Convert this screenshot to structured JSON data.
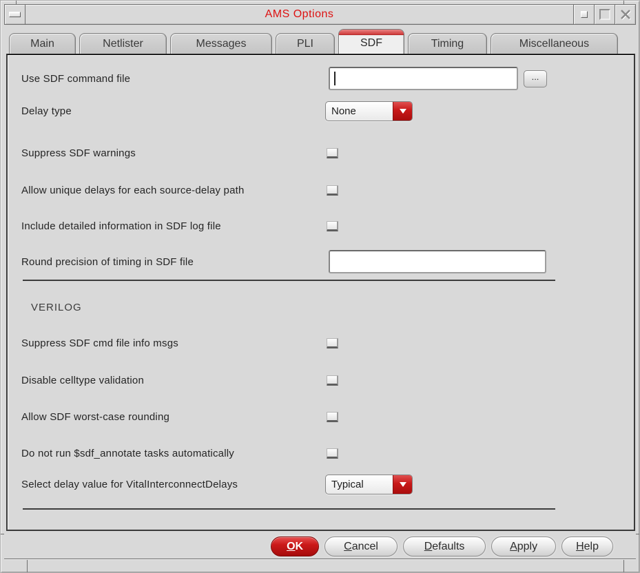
{
  "window": {
    "title": "AMS Options"
  },
  "tabs": [
    {
      "label": "Main",
      "active": false
    },
    {
      "label": "Netlister",
      "active": false
    },
    {
      "label": "Messages",
      "active": false
    },
    {
      "label": "PLI",
      "active": false
    },
    {
      "label": "SDF",
      "active": true
    },
    {
      "label": "Timing",
      "active": false
    },
    {
      "label": "Miscellaneous",
      "active": false
    }
  ],
  "form": {
    "sdf_file": {
      "label": "Use SDF command file",
      "value": "",
      "browse_label": "..."
    },
    "delay_type": {
      "label": "Delay type",
      "value": "None"
    },
    "suppress_warnings": {
      "label": "Suppress SDF warnings",
      "checked": false
    },
    "unique_delays": {
      "label": "Allow unique delays for each source-delay path",
      "checked": false
    },
    "detailed_info": {
      "label": "Include detailed information in SDF log file",
      "checked": false
    },
    "round_precision": {
      "label": "Round precision of timing in SDF file",
      "value": ""
    },
    "verilog_section": {
      "label": "VERILOG"
    },
    "suppress_info_msgs": {
      "label": "Suppress SDF cmd file info msgs",
      "checked": false
    },
    "disable_celltype": {
      "label": "Disable celltype validation",
      "checked": false
    },
    "worst_case": {
      "label": "Allow SDF worst-case rounding",
      "checked": false
    },
    "no_sdf_annotate": {
      "label": "Do not run $sdf_annotate tasks automatically",
      "checked": false
    },
    "vital_delay": {
      "label": "Select delay value for VitalInterconnectDelays",
      "value": "Typical"
    }
  },
  "footer": {
    "ok": "OK",
    "cancel": "Cancel",
    "defaults": "Defaults",
    "apply": "Apply",
    "help": "Help"
  },
  "colors": {
    "accent_red": "#c41414",
    "title_red": "#dd1111",
    "tab_stripe_red": "#d75050",
    "background_grey": "#d9d9d9"
  }
}
